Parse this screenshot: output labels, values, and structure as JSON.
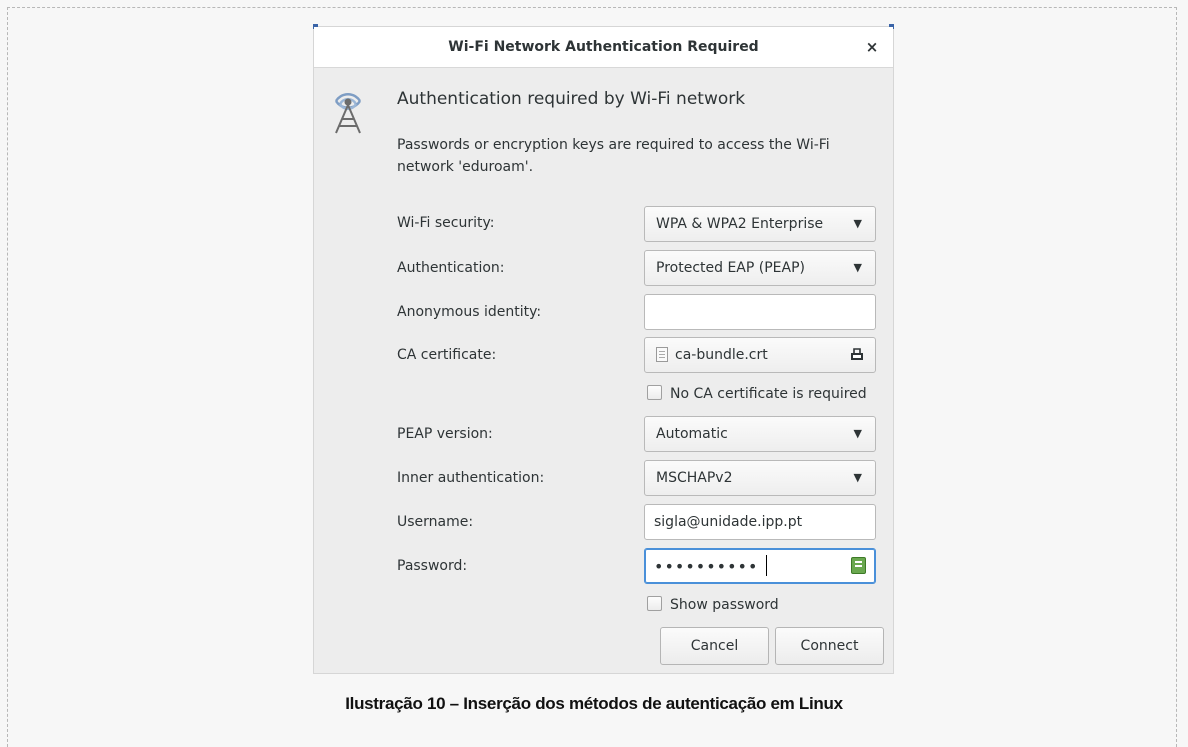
{
  "dialog": {
    "title": "Wi-Fi Network Authentication Required",
    "close_label": "×",
    "heading": "Authentication required by Wi-Fi network",
    "description": "Passwords or encryption keys are required to access the Wi-Fi network 'eduroam'."
  },
  "form": {
    "wifi_security_label": "Wi-Fi security:",
    "wifi_security_value": "WPA & WPA2 Enterprise",
    "authentication_label": "Authentication:",
    "authentication_value": "Protected EAP (PEAP)",
    "anonymous_identity_label": "Anonymous identity:",
    "anonymous_identity_value": "",
    "ca_certificate_label": "CA certificate:",
    "ca_certificate_value": "ca-bundle.crt",
    "no_ca_required_label": "No CA certificate is required",
    "peap_version_label": "PEAP version:",
    "peap_version_value": "Automatic",
    "inner_auth_label": "Inner authentication:",
    "inner_auth_value": "MSCHAPv2",
    "username_label": "Username:",
    "username_value": "sigla@unidade.ipp.pt",
    "password_label": "Password:",
    "password_value": "••••••••••",
    "show_password_label": "Show password"
  },
  "buttons": {
    "cancel_label": "Cancel",
    "connect_label": "Connect"
  },
  "caption": "Ilustração 10 – Inserção dos métodos de autenticação em Linux",
  "icons": [
    "wifi-icon",
    "close-icon",
    "chevron-down-icon",
    "file-icon",
    "folder-open-icon",
    "key-icon"
  ]
}
